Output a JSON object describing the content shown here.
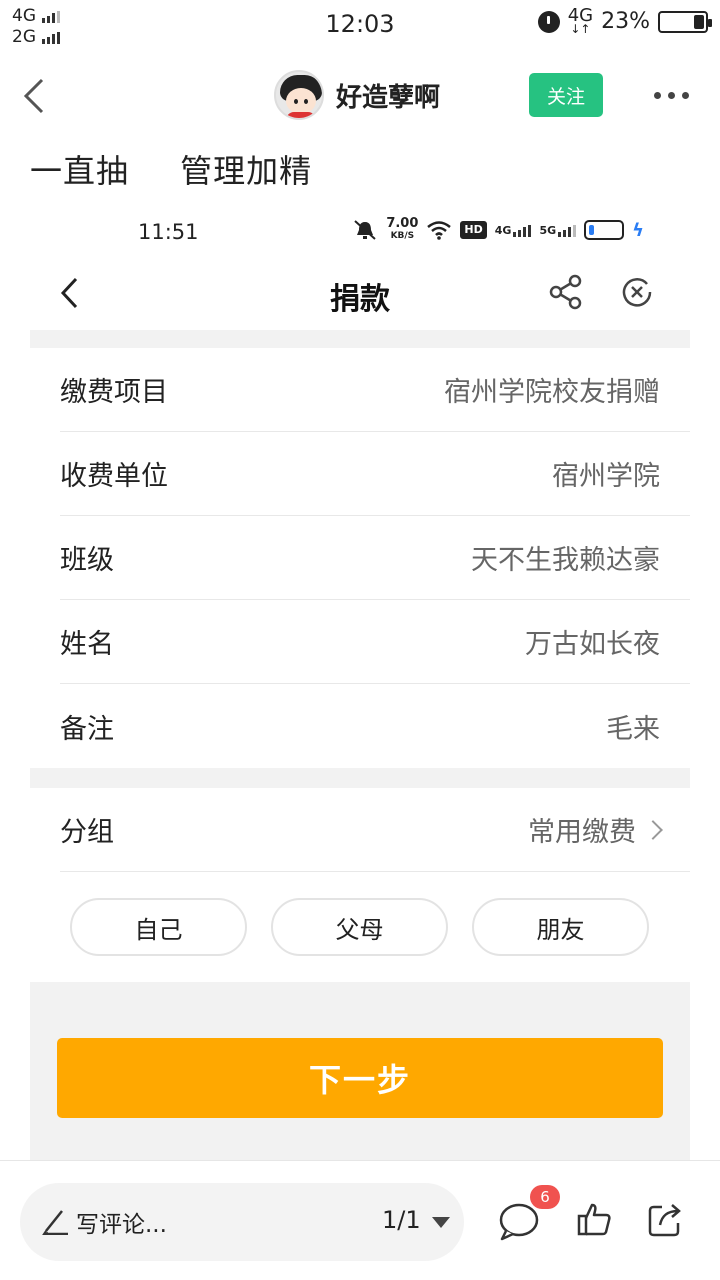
{
  "status_bar": {
    "net1": "4G",
    "net2": "2G",
    "time": "12:03",
    "net_right": "4G",
    "net_arrows": "↓↑",
    "battery": "23%"
  },
  "nav": {
    "author_name": "好造孽啊",
    "follow_label": "关注"
  },
  "post": {
    "title": "一直抽 管理加精"
  },
  "screenshot": {
    "status": {
      "time": "11:51",
      "speed": "7.00",
      "speed_unit": "KB/S",
      "hd_label": "HD",
      "net_4g": "4G",
      "net_5g": "5G",
      "bolt": "ϟ"
    },
    "page_title": "捐款",
    "rows": [
      {
        "label": "缴费项目",
        "value": "宿州学院校友捐赠"
      },
      {
        "label": "收费单位",
        "value": "宿州学院"
      },
      {
        "label": "班级",
        "value": "天不生我赖达豪"
      },
      {
        "label": "姓名",
        "value": "万古如长夜"
      },
      {
        "label": "备注",
        "value": "毛来"
      }
    ],
    "group_row": {
      "label": "分组",
      "value": "常用缴费"
    },
    "chips": [
      "自己",
      "父母",
      "朋友"
    ],
    "next_label": "下一步"
  },
  "bottom": {
    "comment_placeholder": "写评论...",
    "page_indicator": "1/1",
    "comment_count": "6"
  },
  "colors": {
    "follow_green": "#26c281",
    "next_orange": "#ffa800",
    "badge_red": "#f0524f",
    "battery_blue": "#2a7df4"
  }
}
